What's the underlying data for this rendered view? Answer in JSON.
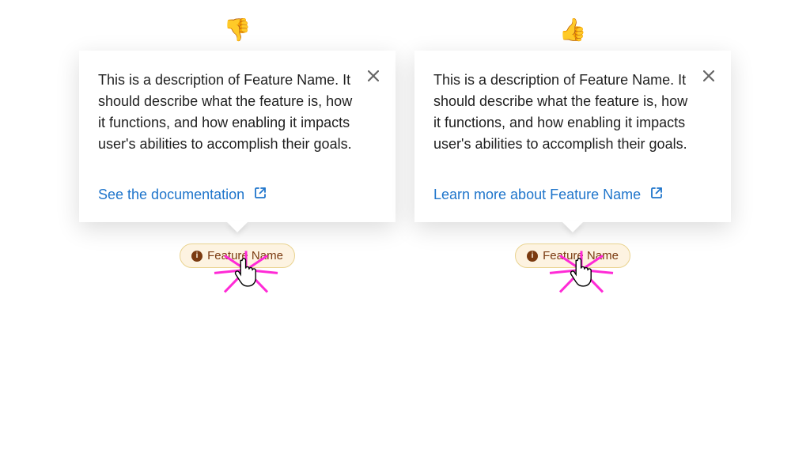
{
  "examples": {
    "bad": {
      "rating_emoji": "👎",
      "popover_text": "This is a description of Feature Name. It should describe what the feature is, how it functions, and how enabling it impacts user's abilities to accomplish their goals.",
      "link_text": "See the documentation",
      "chip_label": "Feature Name"
    },
    "good": {
      "rating_emoji": "👍",
      "popover_text": "This is a description of Feature Name. It should describe what the feature is, how it functions, and how enabling it impacts user's abilities to accomplish their goals.",
      "link_text": "Learn more about Feature Name",
      "chip_label": "Feature Name"
    }
  },
  "colors": {
    "link": "#1f75cb",
    "chip_bg": "#fdf3e1",
    "chip_border": "#e9d38f",
    "chip_text": "#7a3a10",
    "spark": "#ff2ad6"
  }
}
